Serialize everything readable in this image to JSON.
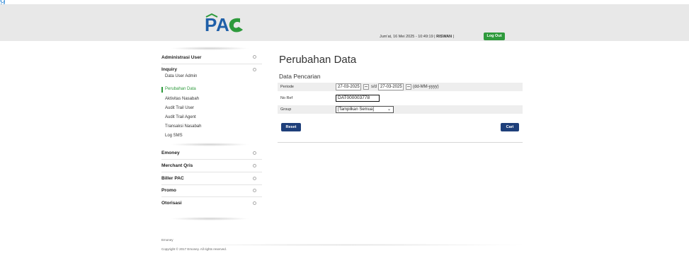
{
  "top_strip": {
    "text": "g"
  },
  "header": {
    "logo_text": "PAC",
    "datetime": "Jum'at, 16 Mei 2025 - 10:49:19",
    "separator": " | ",
    "username": "RISWAN",
    "separator2": " | ",
    "logout_label": "Log Out"
  },
  "sidebar": {
    "menus": [
      {
        "label": "Administrasi User"
      },
      {
        "label": "Inquiry"
      },
      {
        "label": "Emoney"
      },
      {
        "label": "Merchant Qris"
      },
      {
        "label": "Biller PAC"
      },
      {
        "label": "Promo"
      },
      {
        "label": "Otorisasi"
      }
    ],
    "inquiry_items": [
      {
        "label": "Data User Admin"
      },
      {
        "label": "Perubahan Data"
      },
      {
        "label": "Aktivitas Nasabah"
      },
      {
        "label": "Audit Trail User"
      },
      {
        "label": "Audit Trail Agent"
      },
      {
        "label": "Transaksi Nasabah"
      },
      {
        "label": "Log SMS"
      }
    ],
    "active_item": "Perubahan Data"
  },
  "main": {
    "title": "Perubahan Data",
    "section_title": "Data Pencarian",
    "periode_label": "Periode",
    "date_from": "27-03-2025",
    "sd_label": "s/d",
    "date_to": "27-03-2025",
    "date_format": "(dd-MM-yyyy)",
    "noref_label": "No Ref",
    "noref_value": "DAT000003778",
    "group_label": "Group",
    "group_selected": "[Tampilkan Semua]",
    "reset_label": "Reset",
    "cari_label": "Cari"
  },
  "footer": {
    "brand": "Emoney",
    "copyright": "Copyright © 2017 Emoney. All rights reserved."
  },
  "colors": {
    "accent_green": "#2e9a3c",
    "button_blue": "#1e3f7a",
    "header_gray": "#e8e8e8",
    "logo_blue": "#1f5fa8",
    "logo_green": "#2e9a3c"
  }
}
